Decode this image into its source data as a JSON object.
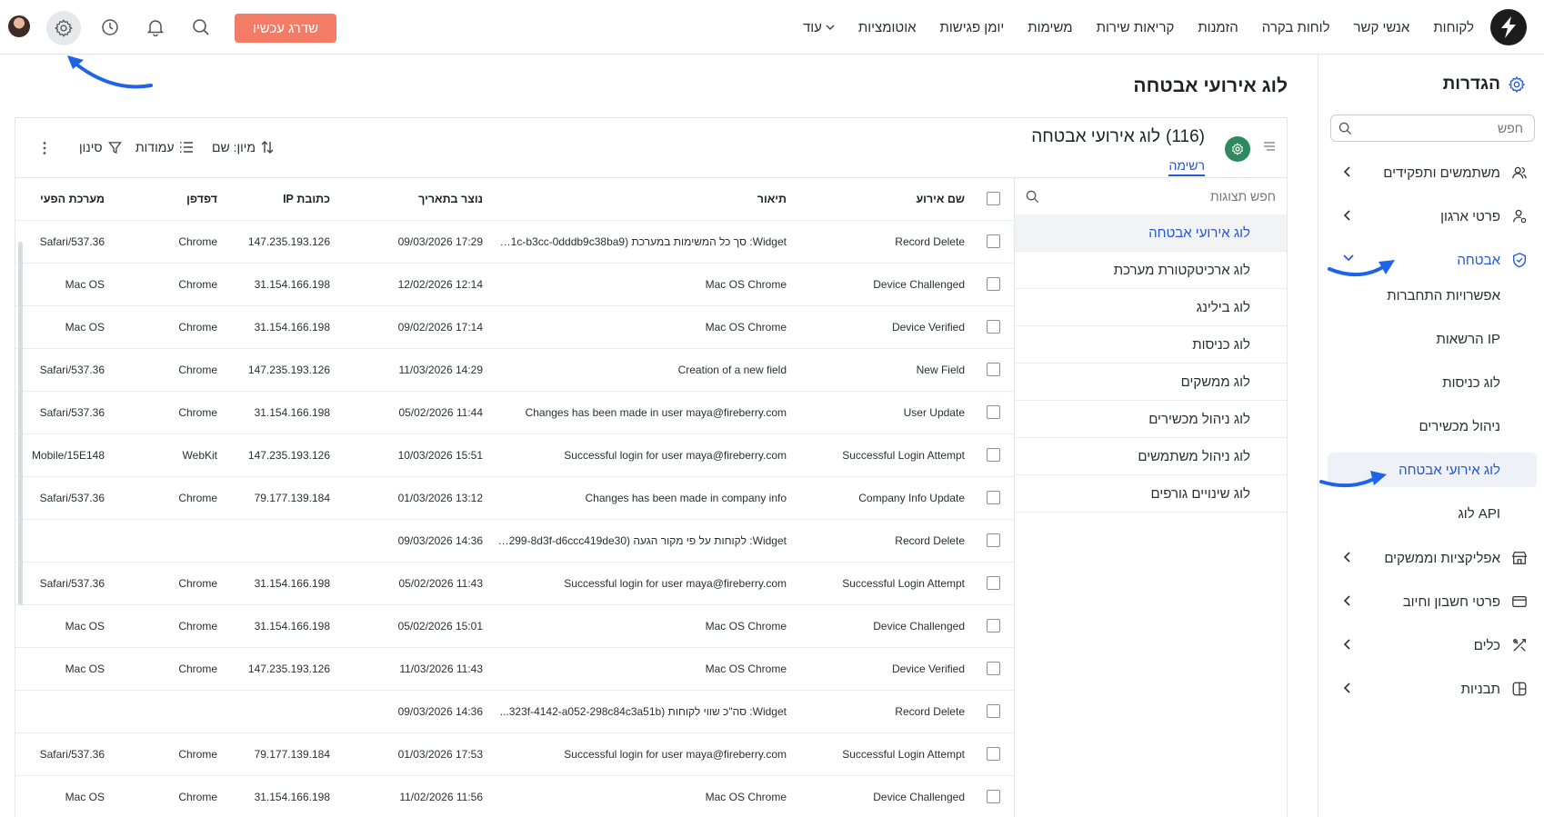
{
  "nav": {
    "items": [
      "לקוחות",
      "אנשי קשר",
      "לוחות בקרה",
      "הזמנות",
      "קריאות שירות",
      "משימות",
      "יומן פגישות",
      "אוטומציות",
      "עוד"
    ],
    "upgrade_label": "שדרג עכשיו"
  },
  "settings": {
    "title": "הגדרות",
    "search_placeholder": "חפש",
    "items": [
      {
        "label": "משתמשים ותפקידים",
        "icon": "users-icon"
      },
      {
        "label": "פרטי ארגון",
        "icon": "org-icon"
      },
      {
        "label": "אבטחה",
        "icon": "shield-icon"
      },
      {
        "label": "אפליקציות וממשקים",
        "icon": "store-icon"
      },
      {
        "label": "פרטי חשבון וחיוב",
        "icon": "card-icon"
      },
      {
        "label": "כלים",
        "icon": "tools-icon"
      },
      {
        "label": "תבניות",
        "icon": "layout-icon"
      }
    ],
    "security_sub": [
      "אפשרויות התחברות",
      "הרשאות IP",
      "לוג כניסות",
      "ניהול מכשירים",
      "לוג אירועי אבטחה",
      "לוג API"
    ]
  },
  "page": {
    "title": "לוג אירועי אבטחה",
    "list_title": "לוג אירועי אבטחה",
    "list_count": "(116)",
    "tab_label": "רשימה",
    "sort_label": "מיון: שם",
    "columns_label": "עמודות",
    "filter_label": "סינון"
  },
  "views": {
    "search_placeholder": "חפש תצוגות",
    "items": [
      "לוג אירועי אבטחה",
      "לוג ארכיטקטורת מערכת",
      "לוג בילינג",
      "לוג כניסות",
      "לוג ממשקים",
      "לוג ניהול מכשירים",
      "לוג ניהול משתמשים",
      "לוג שינויים גורפים"
    ]
  },
  "table": {
    "headers": {
      "event": "שם אירוע",
      "desc": "תיאור",
      "created": "נוצר בתאריך",
      "ip": "כתובת IP",
      "browser": "דפדפן",
      "os": "מערכת הפעי"
    },
    "rows": [
      {
        "event": "Record Delete",
        "desc": "Widget: סך כל המשימות במערכת (51c-b3cc-0dddb9c38ba9...",
        "created": "17:29 09/03/2026",
        "ip": "147.235.193.126",
        "browser": "Chrome",
        "os": "Safari/537.36"
      },
      {
        "event": "Device Challenged",
        "desc": "Mac OS Chrome",
        "created": "12:14 12/02/2026",
        "ip": "31.154.166.198",
        "browser": "Chrome",
        "os": "Mac OS"
      },
      {
        "event": "Device Verified",
        "desc": "Mac OS Chrome",
        "created": "17:14 09/02/2026",
        "ip": "31.154.166.198",
        "browser": "Chrome",
        "os": "Mac OS"
      },
      {
        "event": "New Field",
        "desc": "Creation of a new field",
        "created": "14:29 11/03/2026",
        "ip": "147.235.193.126",
        "browser": "Chrome",
        "os": "Safari/537.36"
      },
      {
        "event": "User Update",
        "desc": "Changes has been made in user maya@fireberry.com",
        "created": "11:44 05/02/2026",
        "ip": "31.154.166.198",
        "browser": "Chrome",
        "os": "Safari/537.36"
      },
      {
        "event": "Successful Login Attempt",
        "desc": "Successful login for user maya@fireberry.com",
        "created": "15:51 10/03/2026",
        "ip": "147.235.193.126",
        "browser": "WebKit",
        "os": "Mobile/15E148"
      },
      {
        "event": "Company Info Update",
        "desc": "Changes has been made in company info",
        "created": "13:12 01/03/2026",
        "ip": "79.177.139.184",
        "browser": "Chrome",
        "os": "Safari/537.36"
      },
      {
        "event": "Record Delete",
        "desc": "Widget: לקוחות על פי מקור הגעה (4299-8d3f-d6ccc419de30...",
        "created": "14:36 09/03/2026",
        "ip": "",
        "browser": "",
        "os": ""
      },
      {
        "event": "Successful Login Attempt",
        "desc": "Successful login for user maya@fireberry.com",
        "created": "11:43 05/02/2026",
        "ip": "31.154.166.198",
        "browser": "Chrome",
        "os": "Safari/537.36"
      },
      {
        "event": "Device Challenged",
        "desc": "Mac OS Chrome",
        "created": "15:01 05/02/2026",
        "ip": "31.154.166.198",
        "browser": "Chrome",
        "os": "Mac OS"
      },
      {
        "event": "Device Verified",
        "desc": "Mac OS Chrome",
        "created": "11:43 11/03/2026",
        "ip": "147.235.193.126",
        "browser": "Chrome",
        "os": "Mac OS"
      },
      {
        "event": "Record Delete",
        "desc": "Widget: סה\"כ שווי לקוחות (323f-4142-a052-298c84c3a51b...",
        "created": "14:36 09/03/2026",
        "ip": "",
        "browser": "",
        "os": ""
      },
      {
        "event": "Successful Login Attempt",
        "desc": "Successful login for user maya@fireberry.com",
        "created": "17:53 01/03/2026",
        "ip": "79.177.139.184",
        "browser": "Chrome",
        "os": "Safari/537.36"
      },
      {
        "event": "Device Challenged",
        "desc": "Mac OS Chrome",
        "created": "11:56 11/02/2026",
        "ip": "31.154.166.198",
        "browser": "Chrome",
        "os": "Mac OS"
      }
    ]
  },
  "colors": {
    "accent": "#2557d6",
    "upgrade": "#f27c66",
    "badge": "#2e8a5e",
    "arrow": "#1f63e8"
  }
}
